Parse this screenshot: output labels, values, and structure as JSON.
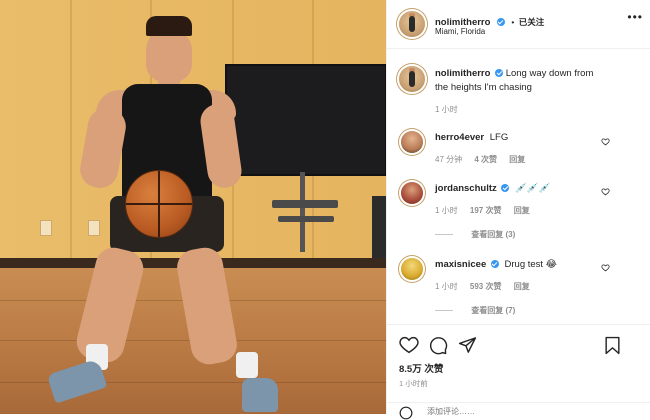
{
  "post": {
    "username": "nolimitherro",
    "follow_status": "已关注",
    "location": "Miami, Florida",
    "more_label": "•••"
  },
  "caption": {
    "username": "nolimitherro",
    "text_line1": "Long way down from",
    "text_line2": "the heights I'm chasing",
    "time": "1 小时"
  },
  "comments": [
    {
      "username": "herro4ever",
      "text": "LFG",
      "time": "47 分钟",
      "likes": "4 次赞",
      "reply": "回复",
      "verified": false,
      "replies_label": ""
    },
    {
      "username": "jordanschultz",
      "text": "💉💉💉",
      "time": "1 小时",
      "likes": "197 次赞",
      "reply": "回复",
      "verified": true,
      "replies_label": "查看回复 (3)"
    },
    {
      "username": "maxisnicee",
      "text": "Drug test 😂",
      "time": "1 小时",
      "likes": "593 次赞",
      "reply": "回复",
      "verified": true,
      "replies_label": "查看回复 (7)"
    }
  ],
  "stats": {
    "likes": "8.5万 次赞",
    "time": "1 小时前"
  },
  "add_comment_placeholder": "添加评论……",
  "icons": {
    "like": "heart-icon",
    "comment": "comment-icon",
    "share": "send-icon",
    "save": "bookmark-icon"
  },
  "colors": {
    "verified": "#3897f0",
    "muted_text": "#8e8e8e",
    "text": "#262626"
  }
}
